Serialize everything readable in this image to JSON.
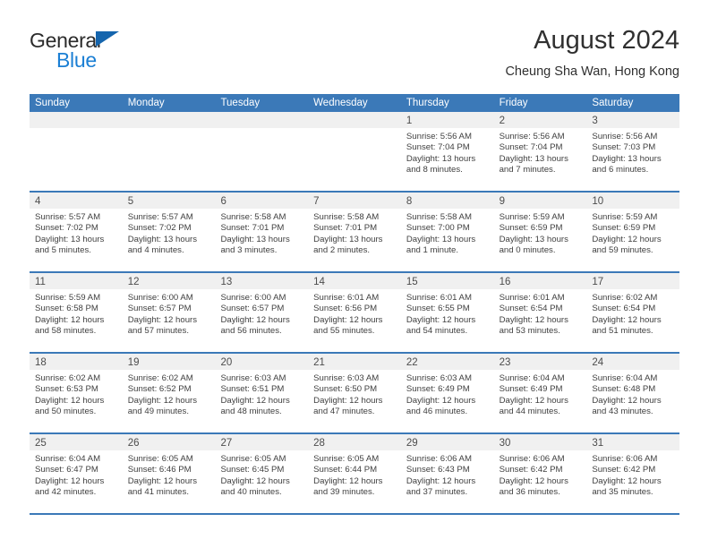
{
  "brand": {
    "word_one": "General",
    "word_two": "Blue",
    "triangle_icon": "blue-triangle-logo-mark"
  },
  "header": {
    "title": "August 2024",
    "subtitle": "Cheung Sha Wan, Hong Kong"
  },
  "colors": {
    "header_blue": "#3b79b8",
    "brand_blue": "#1b7fd4",
    "day_band_gray": "#f0f0f0",
    "text_dark": "#3f3f3f"
  },
  "weekdays": [
    "Sunday",
    "Monday",
    "Tuesday",
    "Wednesday",
    "Thursday",
    "Friday",
    "Saturday"
  ],
  "weeks": [
    [
      {
        "day": "",
        "empty": true
      },
      {
        "day": "",
        "empty": true
      },
      {
        "day": "",
        "empty": true
      },
      {
        "day": "",
        "empty": true
      },
      {
        "day": "1",
        "sunrise": "Sunrise: 5:56 AM",
        "sunset": "Sunset: 7:04 PM",
        "daylight_1": "Daylight: 13 hours",
        "daylight_2": "and 8 minutes."
      },
      {
        "day": "2",
        "sunrise": "Sunrise: 5:56 AM",
        "sunset": "Sunset: 7:04 PM",
        "daylight_1": "Daylight: 13 hours",
        "daylight_2": "and 7 minutes."
      },
      {
        "day": "3",
        "sunrise": "Sunrise: 5:56 AM",
        "sunset": "Sunset: 7:03 PM",
        "daylight_1": "Daylight: 13 hours",
        "daylight_2": "and 6 minutes."
      }
    ],
    [
      {
        "day": "4",
        "sunrise": "Sunrise: 5:57 AM",
        "sunset": "Sunset: 7:02 PM",
        "daylight_1": "Daylight: 13 hours",
        "daylight_2": "and 5 minutes."
      },
      {
        "day": "5",
        "sunrise": "Sunrise: 5:57 AM",
        "sunset": "Sunset: 7:02 PM",
        "daylight_1": "Daylight: 13 hours",
        "daylight_2": "and 4 minutes."
      },
      {
        "day": "6",
        "sunrise": "Sunrise: 5:58 AM",
        "sunset": "Sunset: 7:01 PM",
        "daylight_1": "Daylight: 13 hours",
        "daylight_2": "and 3 minutes."
      },
      {
        "day": "7",
        "sunrise": "Sunrise: 5:58 AM",
        "sunset": "Sunset: 7:01 PM",
        "daylight_1": "Daylight: 13 hours",
        "daylight_2": "and 2 minutes."
      },
      {
        "day": "8",
        "sunrise": "Sunrise: 5:58 AM",
        "sunset": "Sunset: 7:00 PM",
        "daylight_1": "Daylight: 13 hours",
        "daylight_2": "and 1 minute."
      },
      {
        "day": "9",
        "sunrise": "Sunrise: 5:59 AM",
        "sunset": "Sunset: 6:59 PM",
        "daylight_1": "Daylight: 13 hours",
        "daylight_2": "and 0 minutes."
      },
      {
        "day": "10",
        "sunrise": "Sunrise: 5:59 AM",
        "sunset": "Sunset: 6:59 PM",
        "daylight_1": "Daylight: 12 hours",
        "daylight_2": "and 59 minutes."
      }
    ],
    [
      {
        "day": "11",
        "sunrise": "Sunrise: 5:59 AM",
        "sunset": "Sunset: 6:58 PM",
        "daylight_1": "Daylight: 12 hours",
        "daylight_2": "and 58 minutes."
      },
      {
        "day": "12",
        "sunrise": "Sunrise: 6:00 AM",
        "sunset": "Sunset: 6:57 PM",
        "daylight_1": "Daylight: 12 hours",
        "daylight_2": "and 57 minutes."
      },
      {
        "day": "13",
        "sunrise": "Sunrise: 6:00 AM",
        "sunset": "Sunset: 6:57 PM",
        "daylight_1": "Daylight: 12 hours",
        "daylight_2": "and 56 minutes."
      },
      {
        "day": "14",
        "sunrise": "Sunrise: 6:01 AM",
        "sunset": "Sunset: 6:56 PM",
        "daylight_1": "Daylight: 12 hours",
        "daylight_2": "and 55 minutes."
      },
      {
        "day": "15",
        "sunrise": "Sunrise: 6:01 AM",
        "sunset": "Sunset: 6:55 PM",
        "daylight_1": "Daylight: 12 hours",
        "daylight_2": "and 54 minutes."
      },
      {
        "day": "16",
        "sunrise": "Sunrise: 6:01 AM",
        "sunset": "Sunset: 6:54 PM",
        "daylight_1": "Daylight: 12 hours",
        "daylight_2": "and 53 minutes."
      },
      {
        "day": "17",
        "sunrise": "Sunrise: 6:02 AM",
        "sunset": "Sunset: 6:54 PM",
        "daylight_1": "Daylight: 12 hours",
        "daylight_2": "and 51 minutes."
      }
    ],
    [
      {
        "day": "18",
        "sunrise": "Sunrise: 6:02 AM",
        "sunset": "Sunset: 6:53 PM",
        "daylight_1": "Daylight: 12 hours",
        "daylight_2": "and 50 minutes."
      },
      {
        "day": "19",
        "sunrise": "Sunrise: 6:02 AM",
        "sunset": "Sunset: 6:52 PM",
        "daylight_1": "Daylight: 12 hours",
        "daylight_2": "and 49 minutes."
      },
      {
        "day": "20",
        "sunrise": "Sunrise: 6:03 AM",
        "sunset": "Sunset: 6:51 PM",
        "daylight_1": "Daylight: 12 hours",
        "daylight_2": "and 48 minutes."
      },
      {
        "day": "21",
        "sunrise": "Sunrise: 6:03 AM",
        "sunset": "Sunset: 6:50 PM",
        "daylight_1": "Daylight: 12 hours",
        "daylight_2": "and 47 minutes."
      },
      {
        "day": "22",
        "sunrise": "Sunrise: 6:03 AM",
        "sunset": "Sunset: 6:49 PM",
        "daylight_1": "Daylight: 12 hours",
        "daylight_2": "and 46 minutes."
      },
      {
        "day": "23",
        "sunrise": "Sunrise: 6:04 AM",
        "sunset": "Sunset: 6:49 PM",
        "daylight_1": "Daylight: 12 hours",
        "daylight_2": "and 44 minutes."
      },
      {
        "day": "24",
        "sunrise": "Sunrise: 6:04 AM",
        "sunset": "Sunset: 6:48 PM",
        "daylight_1": "Daylight: 12 hours",
        "daylight_2": "and 43 minutes."
      }
    ],
    [
      {
        "day": "25",
        "sunrise": "Sunrise: 6:04 AM",
        "sunset": "Sunset: 6:47 PM",
        "daylight_1": "Daylight: 12 hours",
        "daylight_2": "and 42 minutes."
      },
      {
        "day": "26",
        "sunrise": "Sunrise: 6:05 AM",
        "sunset": "Sunset: 6:46 PM",
        "daylight_1": "Daylight: 12 hours",
        "daylight_2": "and 41 minutes."
      },
      {
        "day": "27",
        "sunrise": "Sunrise: 6:05 AM",
        "sunset": "Sunset: 6:45 PM",
        "daylight_1": "Daylight: 12 hours",
        "daylight_2": "and 40 minutes."
      },
      {
        "day": "28",
        "sunrise": "Sunrise: 6:05 AM",
        "sunset": "Sunset: 6:44 PM",
        "daylight_1": "Daylight: 12 hours",
        "daylight_2": "and 39 minutes."
      },
      {
        "day": "29",
        "sunrise": "Sunrise: 6:06 AM",
        "sunset": "Sunset: 6:43 PM",
        "daylight_1": "Daylight: 12 hours",
        "daylight_2": "and 37 minutes."
      },
      {
        "day": "30",
        "sunrise": "Sunrise: 6:06 AM",
        "sunset": "Sunset: 6:42 PM",
        "daylight_1": "Daylight: 12 hours",
        "daylight_2": "and 36 minutes."
      },
      {
        "day": "31",
        "sunrise": "Sunrise: 6:06 AM",
        "sunset": "Sunset: 6:42 PM",
        "daylight_1": "Daylight: 12 hours",
        "daylight_2": "and 35 minutes."
      }
    ]
  ]
}
